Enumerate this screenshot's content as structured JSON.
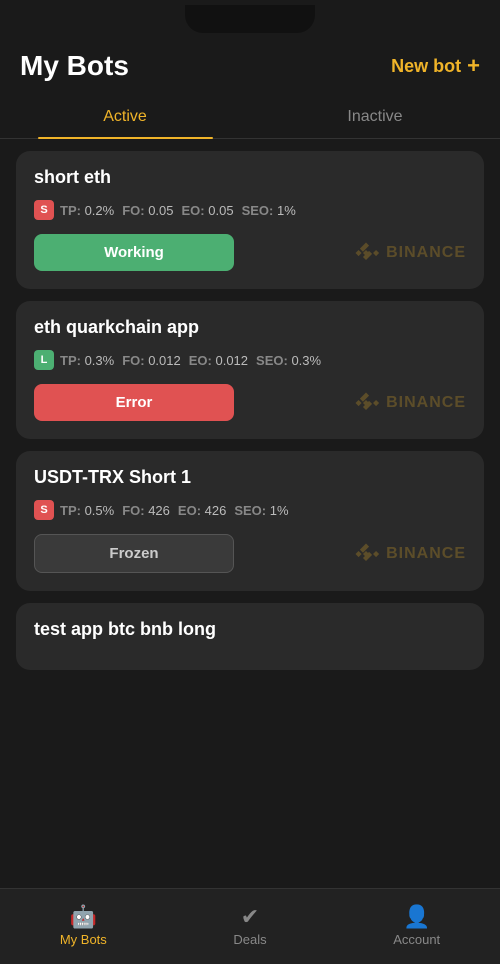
{
  "app": {
    "title": "My Bots",
    "newbot_label": "New bot",
    "newbot_icon": "+"
  },
  "tabs": [
    {
      "id": "active",
      "label": "Active",
      "active": true
    },
    {
      "id": "inactive",
      "label": "Inactive",
      "active": false
    }
  ],
  "bots": [
    {
      "id": "bot1",
      "name": "short eth",
      "badge": "S",
      "badge_color": "red",
      "params": [
        {
          "label": "TP:",
          "value": "0.2%"
        },
        {
          "label": "FO:",
          "value": "0.05"
        },
        {
          "label": "EO:",
          "value": "0.05"
        },
        {
          "label": "SEO:",
          "value": "1%"
        }
      ],
      "status": "Working",
      "status_type": "working",
      "exchange": "BINANCE"
    },
    {
      "id": "bot2",
      "name": "eth quarkchain app",
      "badge": "L",
      "badge_color": "green",
      "params": [
        {
          "label": "TP:",
          "value": "0.3%"
        },
        {
          "label": "FO:",
          "value": "0.012"
        },
        {
          "label": "EO:",
          "value": "0.012"
        },
        {
          "label": "SEO:",
          "value": "0.3%"
        }
      ],
      "status": "Error",
      "status_type": "error",
      "exchange": "BINANCE"
    },
    {
      "id": "bot3",
      "name": "USDT-TRX Short 1",
      "badge": "S",
      "badge_color": "red",
      "params": [
        {
          "label": "TP:",
          "value": "0.5%"
        },
        {
          "label": "FO:",
          "value": "426"
        },
        {
          "label": "EO:",
          "value": "426"
        },
        {
          "label": "SEO:",
          "value": "1%"
        }
      ],
      "status": "Frozen",
      "status_type": "frozen",
      "exchange": "BINANCE"
    },
    {
      "id": "bot4",
      "name": "test app btc bnb long",
      "badge": null,
      "params": [],
      "status": null,
      "status_type": null,
      "exchange": null
    }
  ],
  "nav": [
    {
      "id": "mybots",
      "label": "My Bots",
      "icon": "🤖",
      "active": true
    },
    {
      "id": "deals",
      "label": "Deals",
      "icon": "✔",
      "active": false
    },
    {
      "id": "account",
      "label": "Account",
      "icon": "👤",
      "active": false
    }
  ]
}
